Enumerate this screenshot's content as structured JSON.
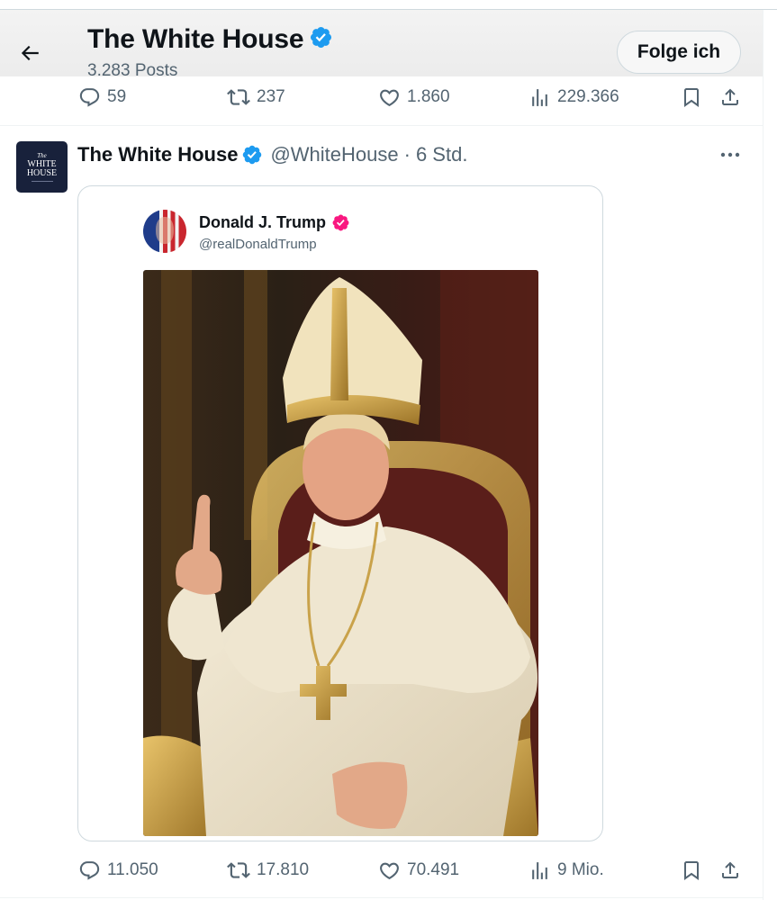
{
  "header": {
    "title": "The White House",
    "posts_count": "3.283 Posts",
    "follow_label": "Folge ich"
  },
  "prev_post_actions": {
    "replies": "59",
    "reposts": "237",
    "likes": "1.860",
    "views": "229.366"
  },
  "post": {
    "author_name": "The White House",
    "handle": "@WhiteHouse",
    "separator": "·",
    "time": "6 Std.",
    "avatar_text": {
      "line1": "The",
      "line2": "WHITE",
      "line3": "HOUSE"
    },
    "embedded": {
      "author_name": "Donald J. Trump",
      "handle": "@realDonaldTrump"
    },
    "actions": {
      "replies": "11.050",
      "reposts": "17.810",
      "likes": "70.491",
      "views": "9 Mio."
    }
  },
  "colors": {
    "verified_blue": "#1d9bf0",
    "verified_pink": "#f91880",
    "muted_text": "#536471",
    "border": "#cfd9de"
  },
  "icons": [
    "back-arrow-icon",
    "verified-badge-icon",
    "reply-icon",
    "repost-icon",
    "like-icon",
    "views-icon",
    "bookmark-icon",
    "share-icon",
    "more-icon"
  ]
}
